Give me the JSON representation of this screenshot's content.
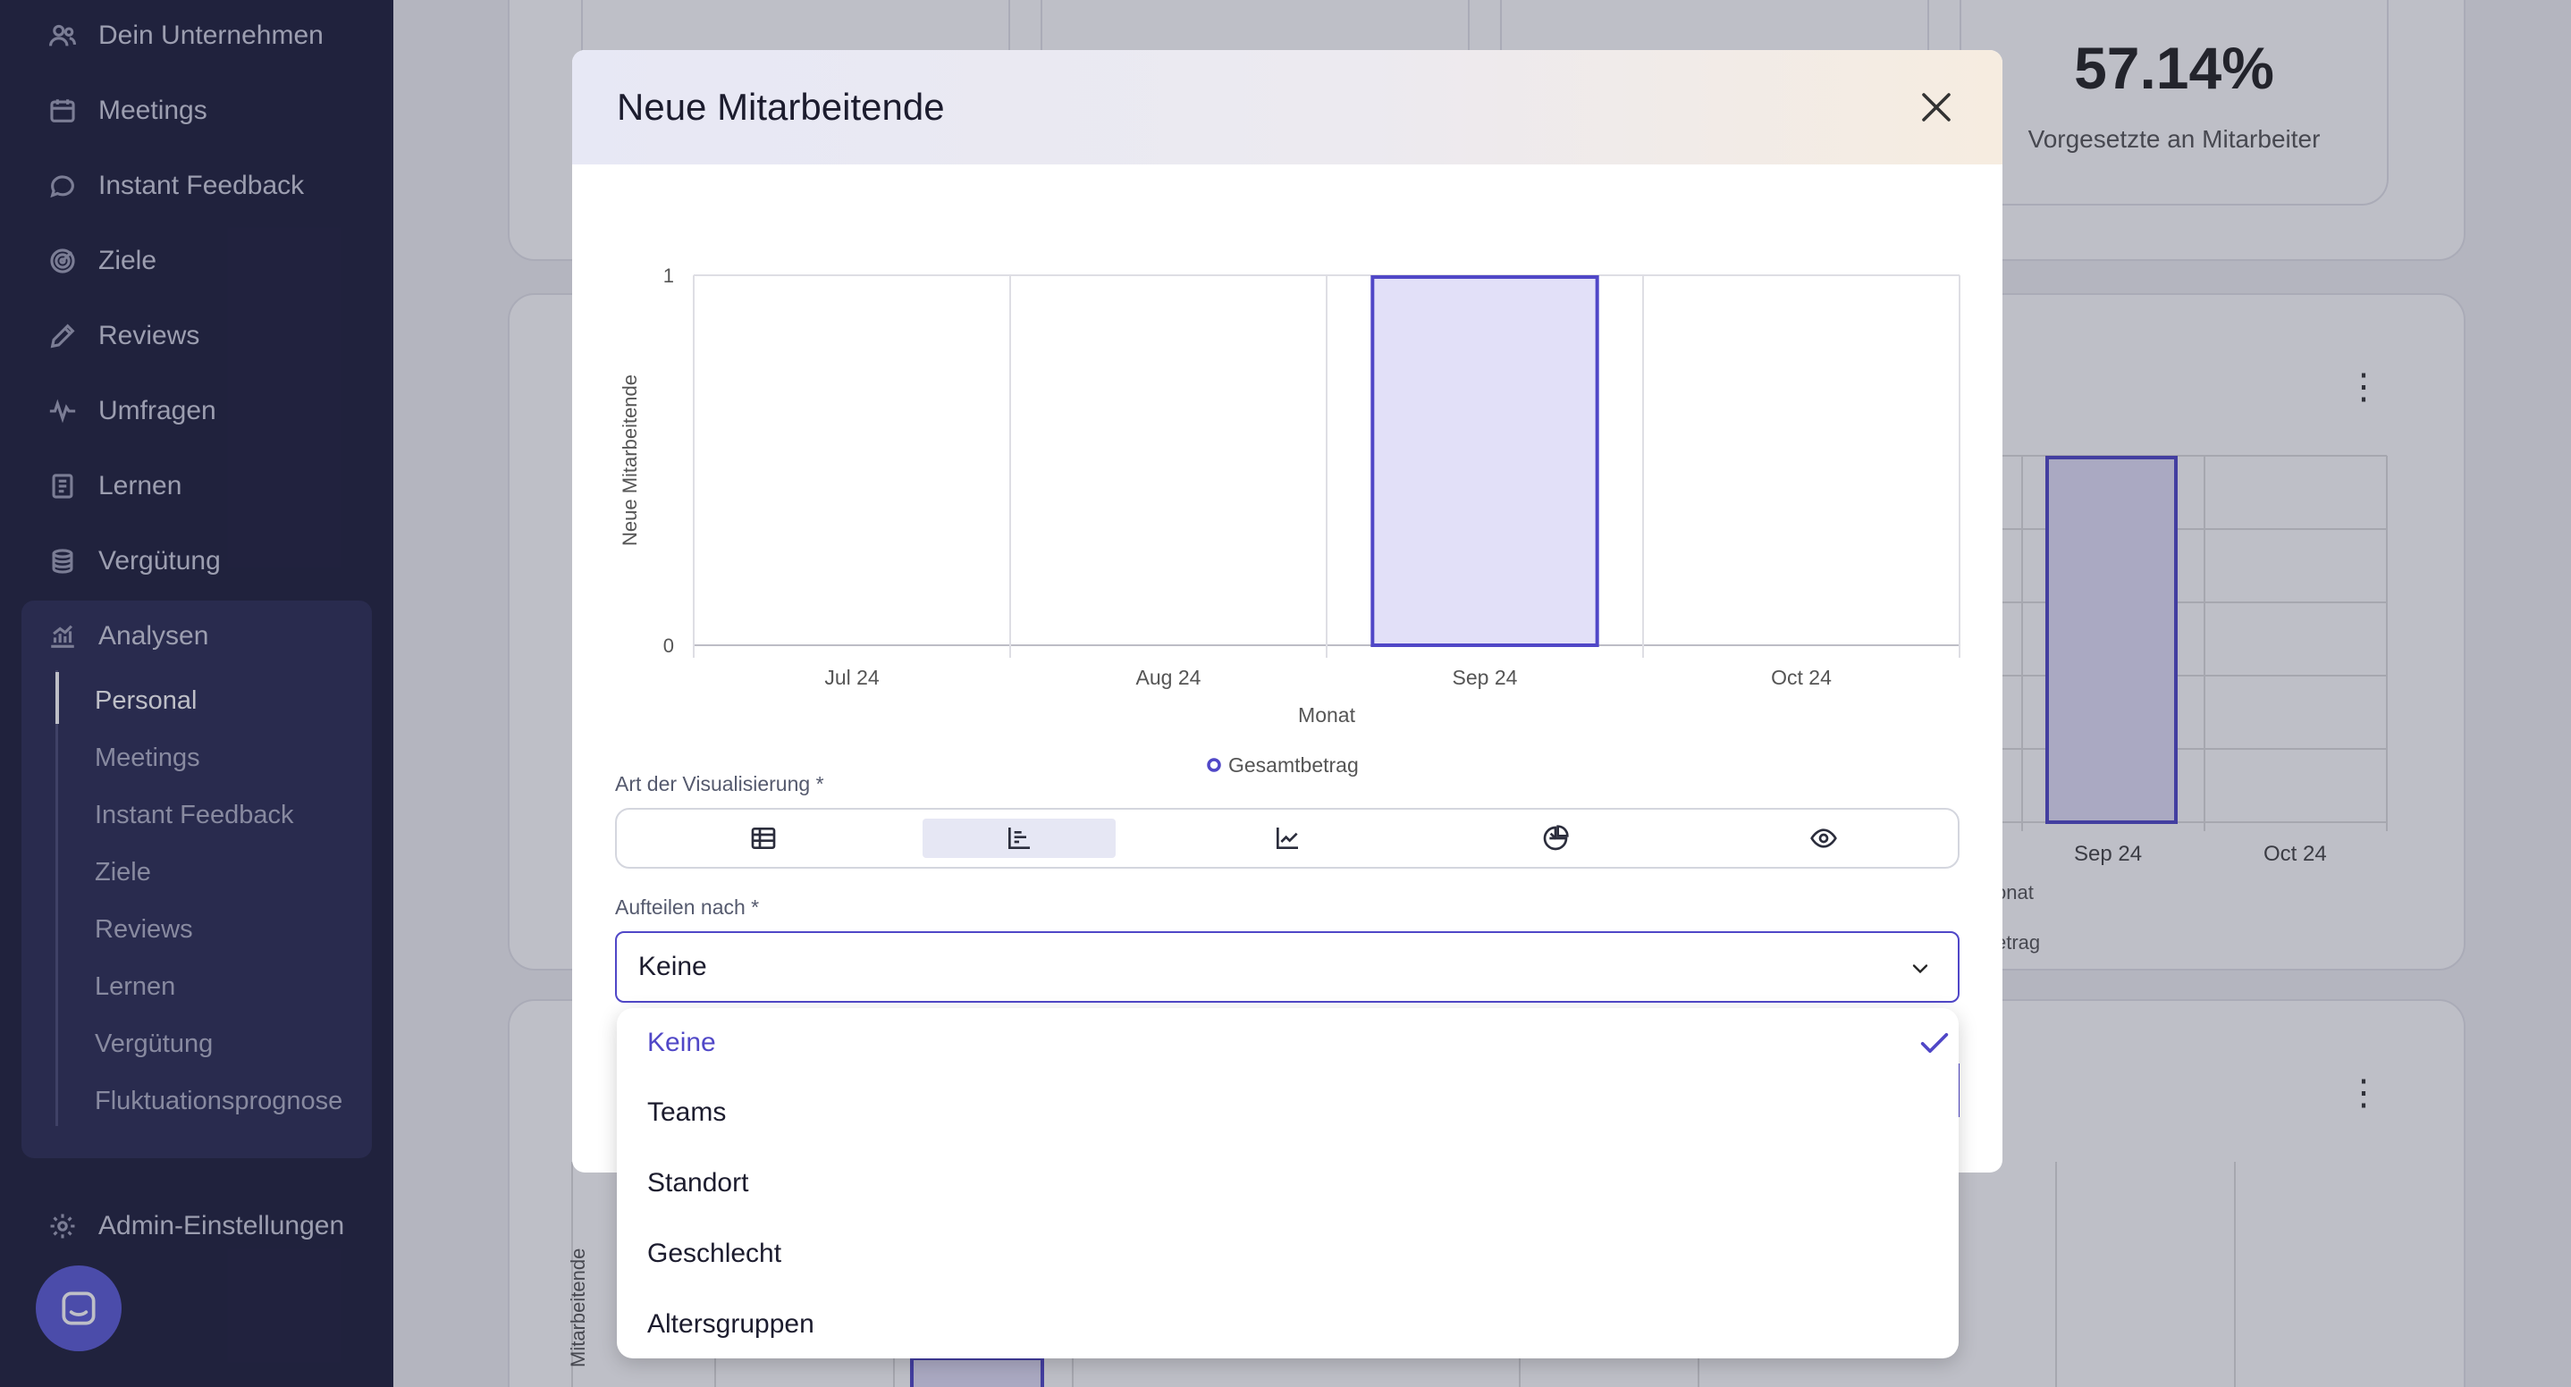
{
  "sidebar": {
    "items": [
      {
        "label": "Dein Unternehmen",
        "icon": "users-icon"
      },
      {
        "label": "Meetings",
        "icon": "calendar-icon"
      },
      {
        "label": "Instant Feedback",
        "icon": "chat-bubble-icon"
      },
      {
        "label": "Ziele",
        "icon": "target-icon"
      },
      {
        "label": "Reviews",
        "icon": "pencil-icon"
      },
      {
        "label": "Umfragen",
        "icon": "pulse-icon"
      },
      {
        "label": "Lernen",
        "icon": "book-icon"
      },
      {
        "label": "Vergütung",
        "icon": "coins-icon"
      },
      {
        "label": "Analysen",
        "icon": "analytics-icon"
      }
    ],
    "analysen_sub": [
      "Personal",
      "Meetings",
      "Instant Feedback",
      "Ziele",
      "Reviews",
      "Lernen",
      "Vergütung",
      "Fluktuationsprognose"
    ],
    "active_sub": "Personal",
    "admin": {
      "label": "Admin-Einstellungen",
      "icon": "gear-icon"
    },
    "chat_icon": "chat-widget-icon"
  },
  "background": {
    "kpi_value": "57.14%",
    "kpi_label": "Vorgesetzte an Mitarbeiter",
    "chart_ticks": [
      "Sep 24",
      "Oct 24"
    ],
    "chart_xlabel_partial": "onat",
    "chart_legend_partial": "etrag",
    "lower_ylabel_partial": "Mitarbeitende"
  },
  "modal": {
    "title": "Neue Mitarbeitende",
    "close_icon": "close-icon",
    "vis_label": "Art der Visualisierung *",
    "vis_options": [
      {
        "icon": "table-icon",
        "selected": false
      },
      {
        "icon": "bar-chart-icon",
        "selected": true
      },
      {
        "icon": "line-chart-icon",
        "selected": false
      },
      {
        "icon": "pie-chart-icon",
        "selected": false
      },
      {
        "icon": "eye-icon",
        "selected": false
      }
    ],
    "split_label": "Aufteilen nach *",
    "split_value": "Keine",
    "dropdown_options": [
      "Keine",
      "Teams",
      "Standort",
      "Geschlecht",
      "Altersgruppen"
    ],
    "dropdown_selected": "Keine",
    "accent_color": "#5047c7"
  },
  "chart_data": {
    "type": "bar",
    "categories": [
      "Jul 24",
      "Aug 24",
      "Sep 24",
      "Oct 24"
    ],
    "series": [
      {
        "name": "Gesamtbetrag",
        "values": [
          0,
          0,
          1,
          0
        ]
      }
    ],
    "xlabel": "Monat",
    "ylabel": "Neue Mitarbeitende",
    "ylim": [
      0,
      1
    ],
    "yticks": [
      "0",
      "1"
    ],
    "grid": true,
    "legend": "bottom-center"
  }
}
